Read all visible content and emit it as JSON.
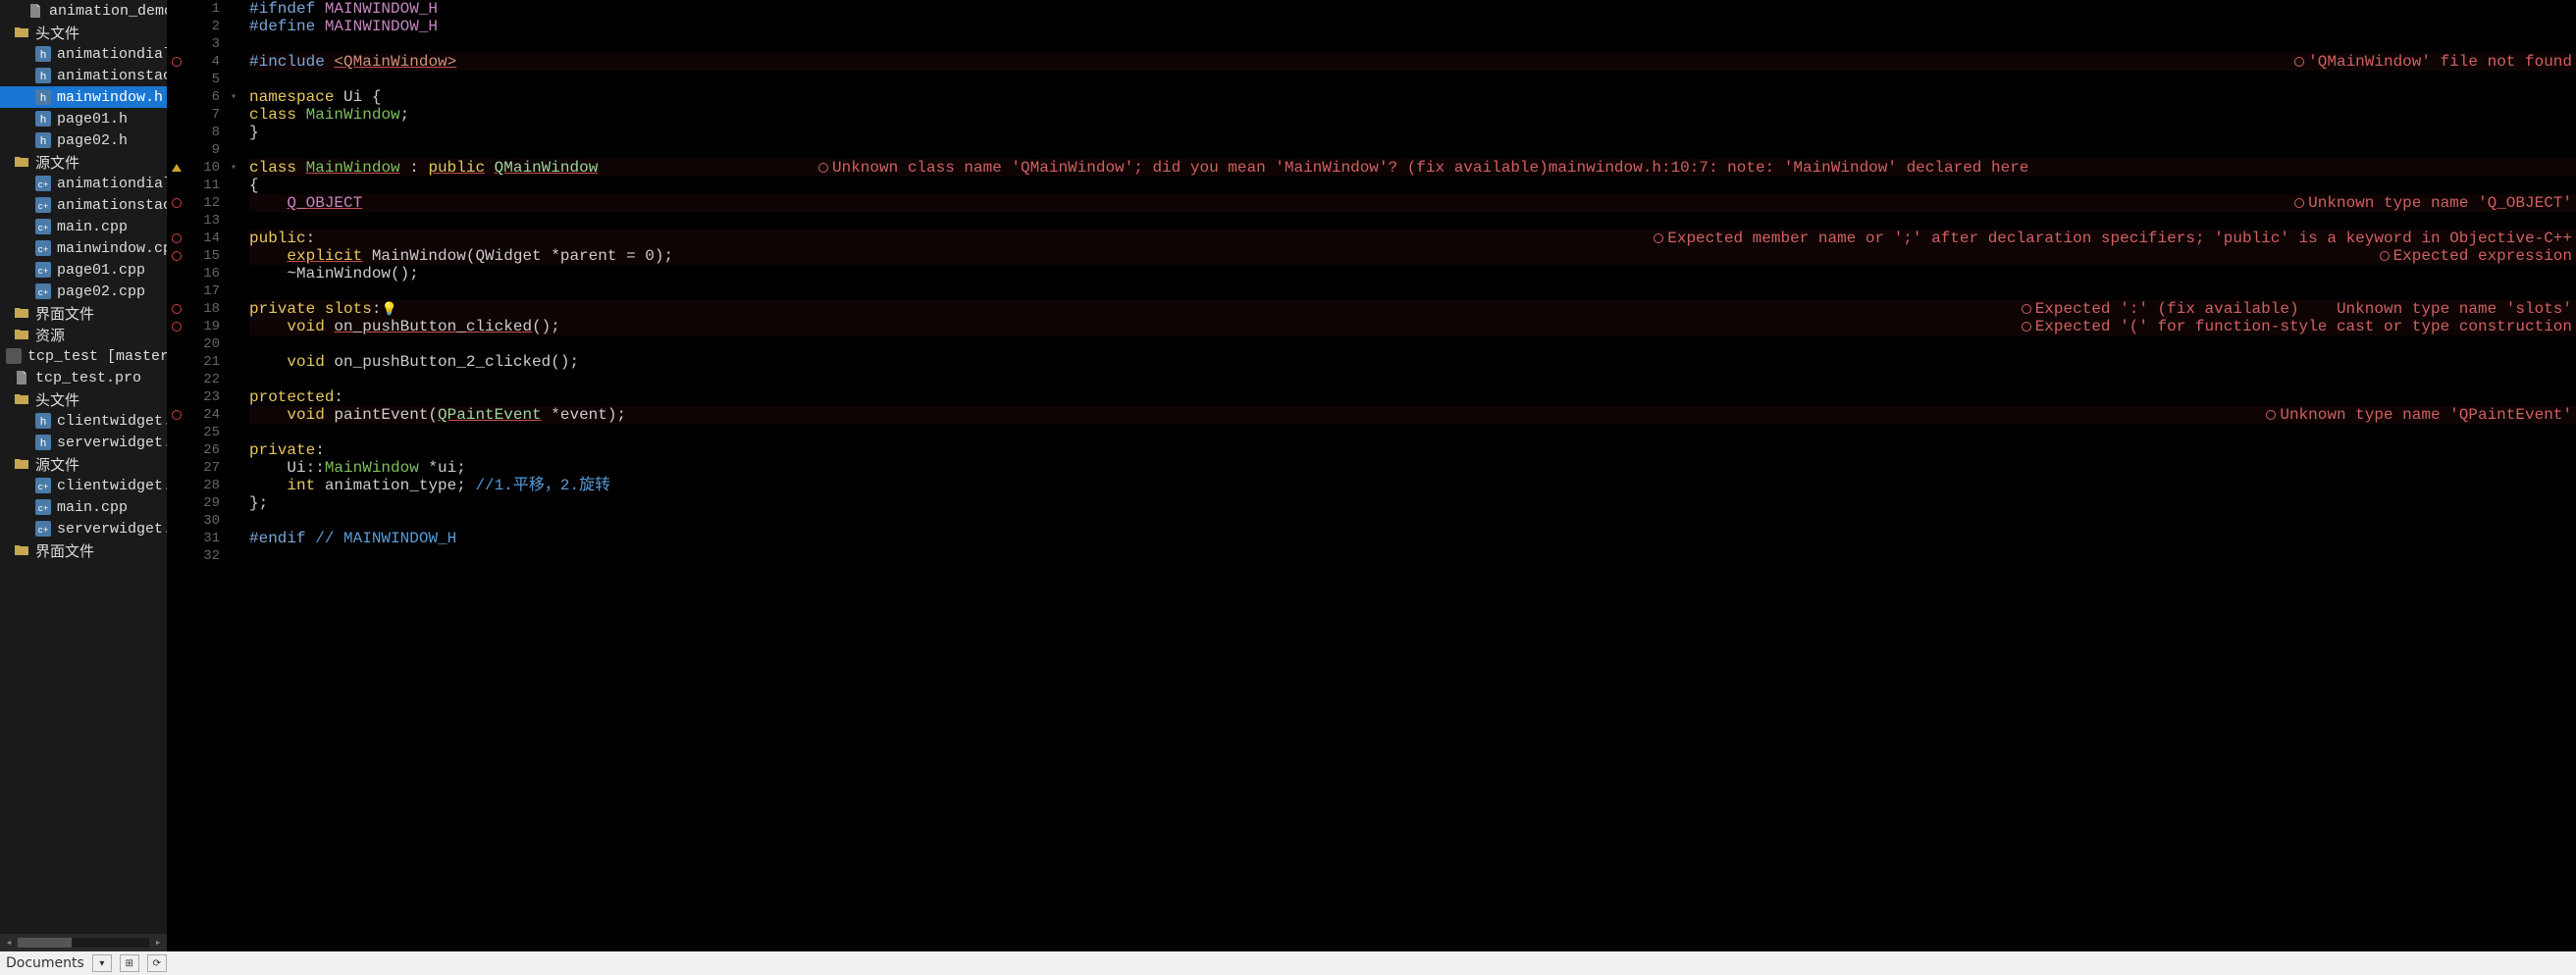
{
  "sidebar": {
    "items": [
      {
        "indent": 22,
        "icon": "file",
        "label": "animation_demo.pr"
      },
      {
        "indent": 8,
        "icon": "folder",
        "label": "头文件"
      },
      {
        "indent": 30,
        "icon": "hfile",
        "label": "animationdialog"
      },
      {
        "indent": 30,
        "icon": "hfile",
        "label": "animationstacke"
      },
      {
        "indent": 30,
        "icon": "hfile",
        "label": "mainwindow.h",
        "selected": true
      },
      {
        "indent": 30,
        "icon": "hfile",
        "label": "page01.h"
      },
      {
        "indent": 30,
        "icon": "hfile",
        "label": "page02.h"
      },
      {
        "indent": 8,
        "icon": "folder",
        "label": "源文件"
      },
      {
        "indent": 30,
        "icon": "cppfile",
        "label": "animationdialog"
      },
      {
        "indent": 30,
        "icon": "cppfile",
        "label": "animationstacke"
      },
      {
        "indent": 30,
        "icon": "cppfile",
        "label": "main.cpp"
      },
      {
        "indent": 30,
        "icon": "cppfile",
        "label": "mainwindow.cpp"
      },
      {
        "indent": 30,
        "icon": "cppfile",
        "label": "page01.cpp"
      },
      {
        "indent": 30,
        "icon": "cppfile",
        "label": "page02.cpp"
      },
      {
        "indent": 8,
        "icon": "folder",
        "label": "界面文件"
      },
      {
        "indent": 8,
        "icon": "folder",
        "label": "资源"
      },
      {
        "indent": 0,
        "icon": "project",
        "label": "tcp_test [master]"
      },
      {
        "indent": 8,
        "icon": "file",
        "label": "tcp_test.pro"
      },
      {
        "indent": 8,
        "icon": "folder",
        "label": "头文件"
      },
      {
        "indent": 30,
        "icon": "hfile",
        "label": "clientwidget.h"
      },
      {
        "indent": 30,
        "icon": "hfile",
        "label": "serverwidget.h"
      },
      {
        "indent": 8,
        "icon": "folder",
        "label": "源文件"
      },
      {
        "indent": 30,
        "icon": "cppfile",
        "label": "clientwidget.cpp"
      },
      {
        "indent": 30,
        "icon": "cppfile",
        "label": "main.cpp"
      },
      {
        "indent": 30,
        "icon": "cppfile",
        "label": "serverwidget.cp"
      },
      {
        "indent": 8,
        "icon": "folder",
        "label": "界面文件"
      }
    ]
  },
  "statusbar": {
    "mode": "Documents"
  },
  "code": {
    "lines": [
      {
        "n": 1,
        "mark": "",
        "fold": "",
        "tokens": [
          [
            "tok-preproc",
            "#ifndef "
          ],
          [
            "tok-macro",
            "MAINWINDOW_H"
          ]
        ]
      },
      {
        "n": 2,
        "mark": "",
        "fold": "",
        "tokens": [
          [
            "tok-preproc",
            "#define "
          ],
          [
            "tok-macro",
            "MAINWINDOW_H"
          ]
        ]
      },
      {
        "n": 3,
        "mark": "",
        "fold": "",
        "tokens": []
      },
      {
        "n": 4,
        "mark": "err",
        "fold": "",
        "tokens": [
          [
            "tok-preproc",
            "#include "
          ],
          [
            "tok-string tok-underline",
            "<QMainWindow>"
          ]
        ],
        "annot": "'QMainWindow' file not found",
        "errbg": true
      },
      {
        "n": 5,
        "mark": "",
        "fold": "",
        "tokens": []
      },
      {
        "n": 6,
        "mark": "",
        "fold": "▾",
        "tokens": [
          [
            "tok-keyword",
            "namespace"
          ],
          [
            "",
            " Ui "
          ],
          [
            "tok-punct",
            "{"
          ]
        ]
      },
      {
        "n": 7,
        "mark": "",
        "fold": "",
        "tokens": [
          [
            "tok-keyword",
            "class"
          ],
          [
            "",
            " "
          ],
          [
            "tok-class",
            "MainWindow"
          ],
          [
            "tok-punct",
            ";"
          ]
        ]
      },
      {
        "n": 8,
        "mark": "",
        "fold": "",
        "tokens": [
          [
            "tok-punct",
            "}"
          ]
        ]
      },
      {
        "n": 9,
        "mark": "",
        "fold": "",
        "tokens": []
      },
      {
        "n": 10,
        "mark": "warn",
        "fold": "▾",
        "tokens": [
          [
            "tok-keyword",
            "class"
          ],
          [
            "",
            " "
          ],
          [
            "tok-class tok-underline",
            "MainWindow"
          ],
          [
            "",
            " : "
          ],
          [
            "tok-keyword tok-underline",
            "public"
          ],
          [
            "",
            " "
          ],
          [
            "tok-type tok-underline",
            "QMainWindow"
          ]
        ],
        "annot": "Unknown class name 'QMainWindow'; did you mean 'MainWindow'? (fix available)mainwindow.h:10:7: note: 'MainWindow' declared here",
        "errbg": true,
        "annotLeft": true
      },
      {
        "n": 11,
        "mark": "",
        "fold": "",
        "tokens": [
          [
            "tok-punct",
            "{"
          ]
        ]
      },
      {
        "n": 12,
        "mark": "err",
        "fold": "",
        "tokens": [
          [
            "",
            "    "
          ],
          [
            "tok-macro tok-underline",
            "Q_OBJECT"
          ]
        ],
        "annot": "Unknown type name 'Q_OBJECT'",
        "errbg": true
      },
      {
        "n": 13,
        "mark": "",
        "fold": "",
        "tokens": []
      },
      {
        "n": 14,
        "mark": "err",
        "fold": "",
        "tokens": [
          [
            "tok-keyword",
            "public"
          ],
          [
            "tok-punct",
            ":"
          ]
        ],
        "annot": "Expected member name or ';' after declaration specifiers; 'public' is a keyword in Objective-C++",
        "errbg": true
      },
      {
        "n": 15,
        "mark": "err",
        "fold": "",
        "tokens": [
          [
            "",
            "    "
          ],
          [
            "tok-keyword tok-underline",
            "explicit"
          ],
          [
            "",
            " MainWindow(QWidget *parent = 0);"
          ]
        ],
        "annot": "Expected expression",
        "errbg": true
      },
      {
        "n": 16,
        "mark": "",
        "fold": "",
        "tokens": [
          [
            "",
            "    ~MainWindow();"
          ]
        ]
      },
      {
        "n": 17,
        "mark": "",
        "fold": "",
        "tokens": []
      },
      {
        "n": 18,
        "mark": "err",
        "fold": "",
        "tokens": [
          [
            "tok-keyword",
            "private"
          ],
          [
            "",
            " "
          ],
          [
            "tok-keyword",
            "slots"
          ],
          [
            "tok-punct",
            ":"
          ],
          [
            "bulb",
            "💡"
          ]
        ],
        "annot": "Expected ':' (fix available)    Unknown type name 'slots'",
        "errbg": true
      },
      {
        "n": 19,
        "mark": "err",
        "fold": "",
        "tokens": [
          [
            "",
            "    "
          ],
          [
            "tok-keyword",
            "void"
          ],
          [
            "",
            " "
          ],
          [
            "tok-func tok-underline",
            "on_pushButton_clicked"
          ],
          [
            "",
            "();"
          ]
        ],
        "annot": "Expected '(' for function-style cast or type construction",
        "errbg": true
      },
      {
        "n": 20,
        "mark": "",
        "fold": "",
        "tokens": []
      },
      {
        "n": 21,
        "mark": "",
        "fold": "",
        "tokens": [
          [
            "",
            "    "
          ],
          [
            "tok-keyword",
            "void"
          ],
          [
            "",
            " on_pushButton_2_clicked();"
          ]
        ]
      },
      {
        "n": 22,
        "mark": "",
        "fold": "",
        "tokens": []
      },
      {
        "n": 23,
        "mark": "",
        "fold": "",
        "tokens": [
          [
            "tok-keyword",
            "protected"
          ],
          [
            "tok-punct",
            ":"
          ]
        ]
      },
      {
        "n": 24,
        "mark": "err",
        "fold": "",
        "tokens": [
          [
            "",
            "    "
          ],
          [
            "tok-keyword",
            "void"
          ],
          [
            "",
            " paintEvent("
          ],
          [
            "tok-type tok-underline",
            "QPaintEvent"
          ],
          [
            "",
            " *event);"
          ]
        ],
        "annot": "Unknown type name 'QPaintEvent'",
        "errbg": true
      },
      {
        "n": 25,
        "mark": "",
        "fold": "",
        "tokens": []
      },
      {
        "n": 26,
        "mark": "",
        "fold": "",
        "tokens": [
          [
            "tok-keyword",
            "private"
          ],
          [
            "tok-punct",
            ":"
          ]
        ]
      },
      {
        "n": 27,
        "mark": "",
        "fold": "",
        "tokens": [
          [
            "",
            "    Ui::"
          ],
          [
            "tok-class",
            "MainWindow"
          ],
          [
            "",
            " *ui;"
          ]
        ]
      },
      {
        "n": 28,
        "mark": "",
        "fold": "",
        "tokens": [
          [
            "",
            "    "
          ],
          [
            "tok-keyword",
            "int"
          ],
          [
            "",
            " animation_type; "
          ],
          [
            "tok-comment",
            "//1.平移，2.旋转"
          ]
        ]
      },
      {
        "n": 29,
        "mark": "",
        "fold": "",
        "tokens": [
          [
            "tok-punct",
            "};"
          ]
        ]
      },
      {
        "n": 30,
        "mark": "",
        "fold": "",
        "tokens": []
      },
      {
        "n": 31,
        "mark": "",
        "fold": "",
        "tokens": [
          [
            "tok-preproc",
            "#endif "
          ],
          [
            "tok-comment",
            "// MAINWINDOW_H"
          ]
        ]
      },
      {
        "n": 32,
        "mark": "",
        "fold": "",
        "tokens": []
      }
    ]
  }
}
